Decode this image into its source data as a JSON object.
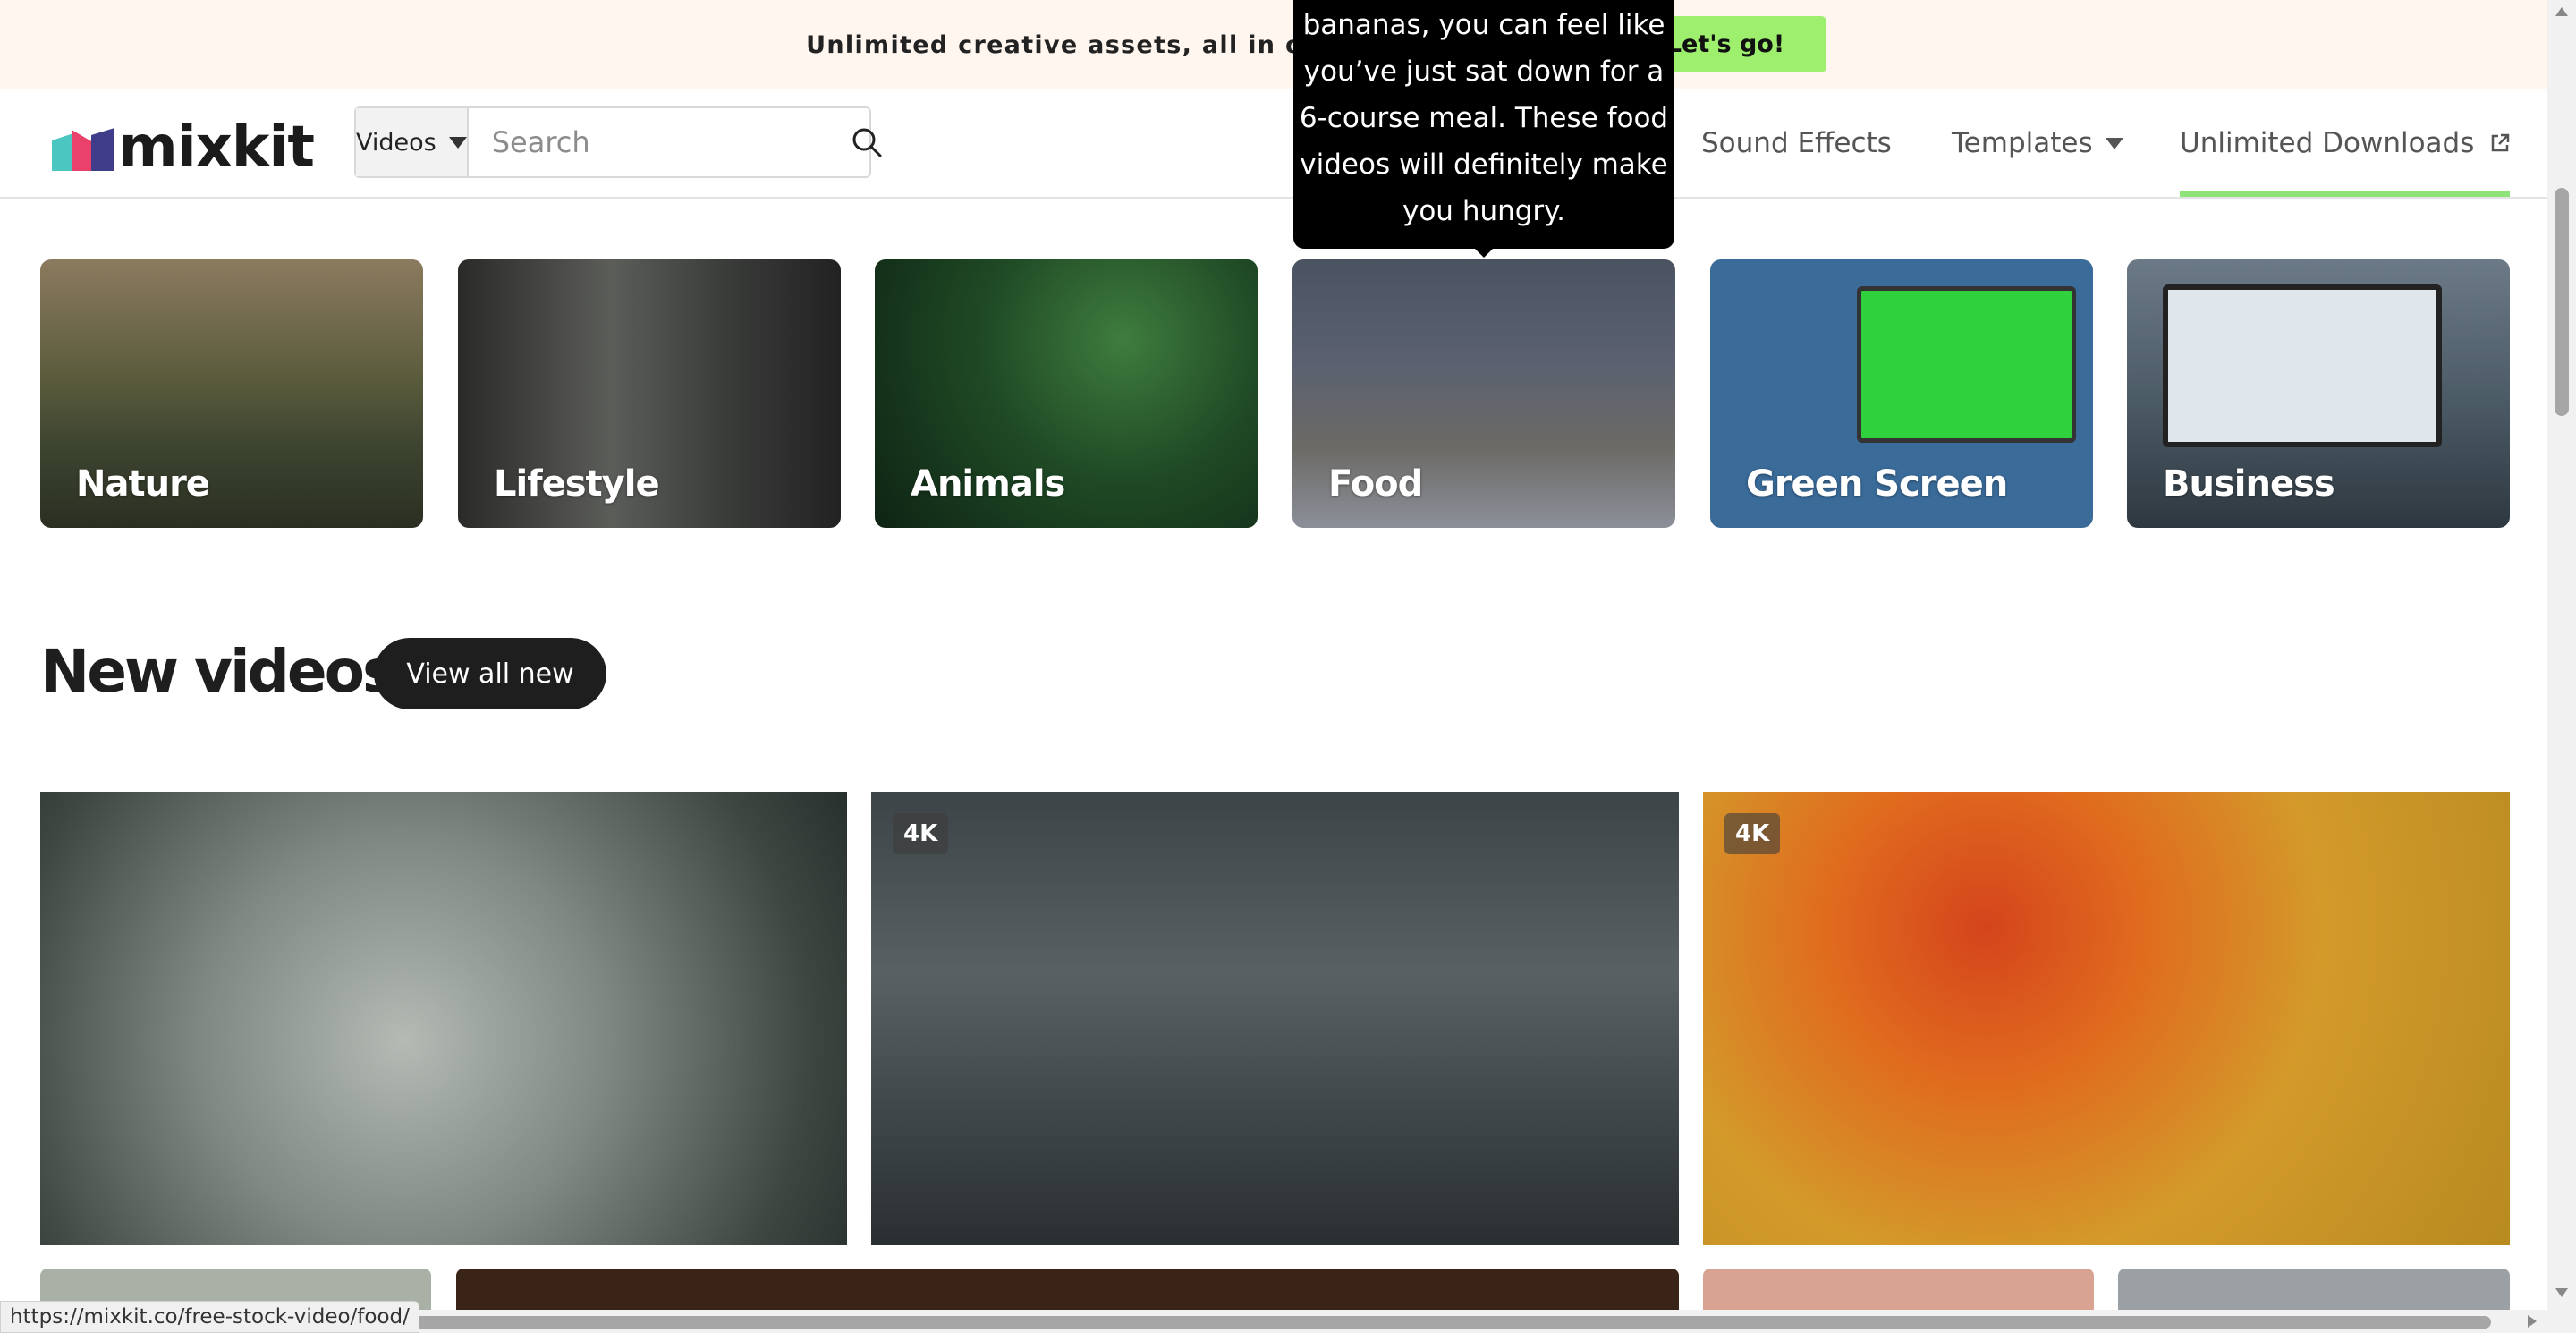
{
  "banner": {
    "text": "Unlimited creative assets, all in one place.",
    "button": "Let's go!"
  },
  "header": {
    "logo": "mixkit",
    "search": {
      "type": "Videos",
      "placeholder": "Search"
    },
    "nav": {
      "sound_effects": "Sound Effects",
      "templates": "Templates",
      "unlimited": "Unlimited Downloads"
    }
  },
  "tooltip": {
    "lines": [
      "bananas, you can feel like",
      "you’ve just sat down for a",
      "6-course meal. These food",
      "videos will definitely make",
      "you hungry."
    ]
  },
  "categories": [
    {
      "label": "Nature"
    },
    {
      "label": "Lifestyle"
    },
    {
      "label": "Animals"
    },
    {
      "label": "Food"
    },
    {
      "label": "Green Screen"
    },
    {
      "label": "Business"
    }
  ],
  "new_videos": {
    "title": "New videos",
    "button": "View all new",
    "badges": [
      "4K",
      "4K"
    ]
  },
  "status_bar": {
    "url": "https://mixkit.co/free-stock-video/food/"
  },
  "icons": [
    "search-icon",
    "caret-down-icon",
    "external-link-icon"
  ],
  "colors": {
    "banner_bg": "#fff6f0",
    "cta": "#9fef6f",
    "active_underline": "#8ee27a"
  }
}
